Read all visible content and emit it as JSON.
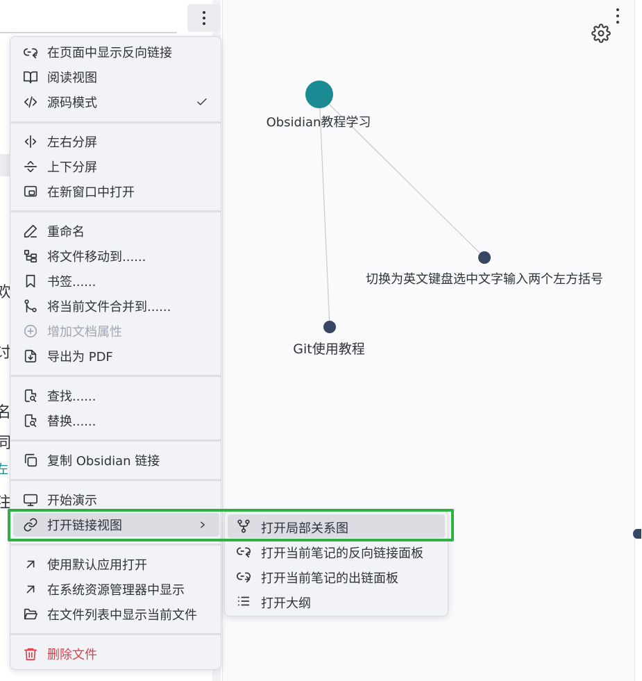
{
  "context_menu": {
    "groups": [
      [
        {
          "id": "show-backlinks",
          "label": "在页面中显示反向链接",
          "icon": "backlink-icon"
        },
        {
          "id": "reading-view",
          "label": "阅读视图",
          "icon": "book-open-icon"
        },
        {
          "id": "source-mode",
          "label": "源码模式",
          "icon": "code-icon",
          "checked": true
        }
      ],
      [
        {
          "id": "split-right",
          "label": "左右分屏",
          "icon": "split-vertical-icon"
        },
        {
          "id": "split-down",
          "label": "上下分屏",
          "icon": "split-horizontal-icon"
        },
        {
          "id": "open-new-window",
          "label": "在新窗口中打开",
          "icon": "new-window-icon"
        }
      ],
      [
        {
          "id": "rename",
          "label": "重命名",
          "icon": "pencil-icon"
        },
        {
          "id": "move-file",
          "label": "将文件移动到......",
          "icon": "folder-tree-icon"
        },
        {
          "id": "bookmark",
          "label": "书签......",
          "icon": "bookmark-icon"
        },
        {
          "id": "merge-file",
          "label": "将当前文件合并到......",
          "icon": "git-merge-icon"
        },
        {
          "id": "add-property",
          "label": "增加文档属性",
          "icon": "plus-circle-icon",
          "disabled": true
        },
        {
          "id": "export-pdf",
          "label": "导出为 PDF",
          "icon": "file-download-icon"
        }
      ],
      [
        {
          "id": "find",
          "label": "查找......",
          "icon": "file-search-icon"
        },
        {
          "id": "replace",
          "label": "替换......",
          "icon": "file-search-icon"
        }
      ],
      [
        {
          "id": "copy-link",
          "label": "复制 Obsidian 链接",
          "icon": "copy-icon"
        }
      ],
      [
        {
          "id": "start-presentation",
          "label": "开始演示",
          "icon": "monitor-icon"
        },
        {
          "id": "open-linked-view",
          "label": "打开链接视图",
          "icon": "link-icon",
          "submenu": true,
          "active": true
        }
      ],
      [
        {
          "id": "open-default-app",
          "label": "使用默认应用打开",
          "icon": "arrow-up-right-icon"
        },
        {
          "id": "show-in-explorer",
          "label": "在系统资源管理器中显示",
          "icon": "arrow-up-right-icon"
        },
        {
          "id": "reveal-in-file-list",
          "label": "在文件列表中显示当前文件",
          "icon": "folder-open-icon"
        }
      ],
      [
        {
          "id": "delete-file",
          "label": "删除文件",
          "icon": "trash-icon",
          "danger": true
        }
      ]
    ]
  },
  "submenu": {
    "items": [
      {
        "id": "open-local-graph",
        "label": "打开局部关系图",
        "icon": "git-fork-icon",
        "active": true
      },
      {
        "id": "open-backlinks-pane",
        "label": "打开当前笔记的反向链接面板",
        "icon": "backlink-icon"
      },
      {
        "id": "open-outgoing-pane",
        "label": "打开当前笔记的出链面板",
        "icon": "outgoing-link-icon"
      },
      {
        "id": "open-outline",
        "label": "打开大纲",
        "icon": "list-icon"
      }
    ]
  },
  "graph": {
    "nodes": [
      {
        "id": "obsidian",
        "label": "Obsidian教程学习",
        "primary": true
      },
      {
        "id": "english-kb",
        "label": "切换为英文键盘选中文字输入两个左方括号"
      },
      {
        "id": "git",
        "label": "Git使用教程"
      }
    ],
    "colors": {
      "primary_node": "#1b8a92",
      "node": "#374663",
      "edge": "#c8c8cc"
    }
  },
  "editor_peek": [
    "欢",
    "讨",
    "名",
    "同",
    "左",
    "注"
  ],
  "colors": {
    "highlight": "#2fb042",
    "danger": "#e03e4a",
    "menu_bg": "#f2f3f7"
  }
}
